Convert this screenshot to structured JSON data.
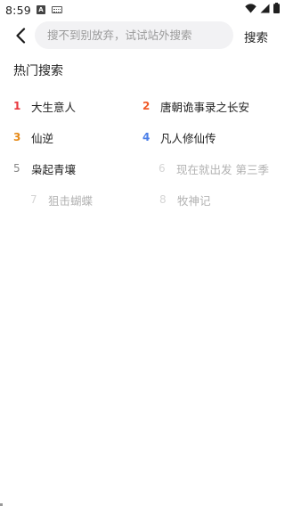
{
  "status_bar": {
    "time": "8:59",
    "notif_icon_label": "A"
  },
  "header": {
    "search_placeholder": "搜不到别放弃，试试站外搜索",
    "search_value": "",
    "search_button_label": "搜索"
  },
  "hot_search": {
    "title": "热门搜索",
    "items": [
      {
        "rank": "1",
        "title": "大生意人"
      },
      {
        "rank": "2",
        "title": "唐朝诡事录之长安"
      },
      {
        "rank": "3",
        "title": "仙逆"
      },
      {
        "rank": "4",
        "title": "凡人修仙传"
      },
      {
        "rank": "5",
        "title": "枭起青壤"
      },
      {
        "rank": "6",
        "title": "现在就出发 第三季"
      },
      {
        "rank": "7",
        "title": "狙击蝴蝶"
      },
      {
        "rank": "8",
        "title": "牧神记"
      }
    ]
  },
  "colors": {
    "rank_1": "#e8373d",
    "rank_2": "#f05a28",
    "rank_3": "#e68a18",
    "rank_4": "#4a7ee8",
    "rank_other": "#888888",
    "search_box_bg": "#f2f2f4"
  },
  "icons": {
    "back": "chevron-left-icon",
    "wifi": "wifi-icon",
    "signal": "cell-signal-icon",
    "battery": "battery-icon"
  }
}
